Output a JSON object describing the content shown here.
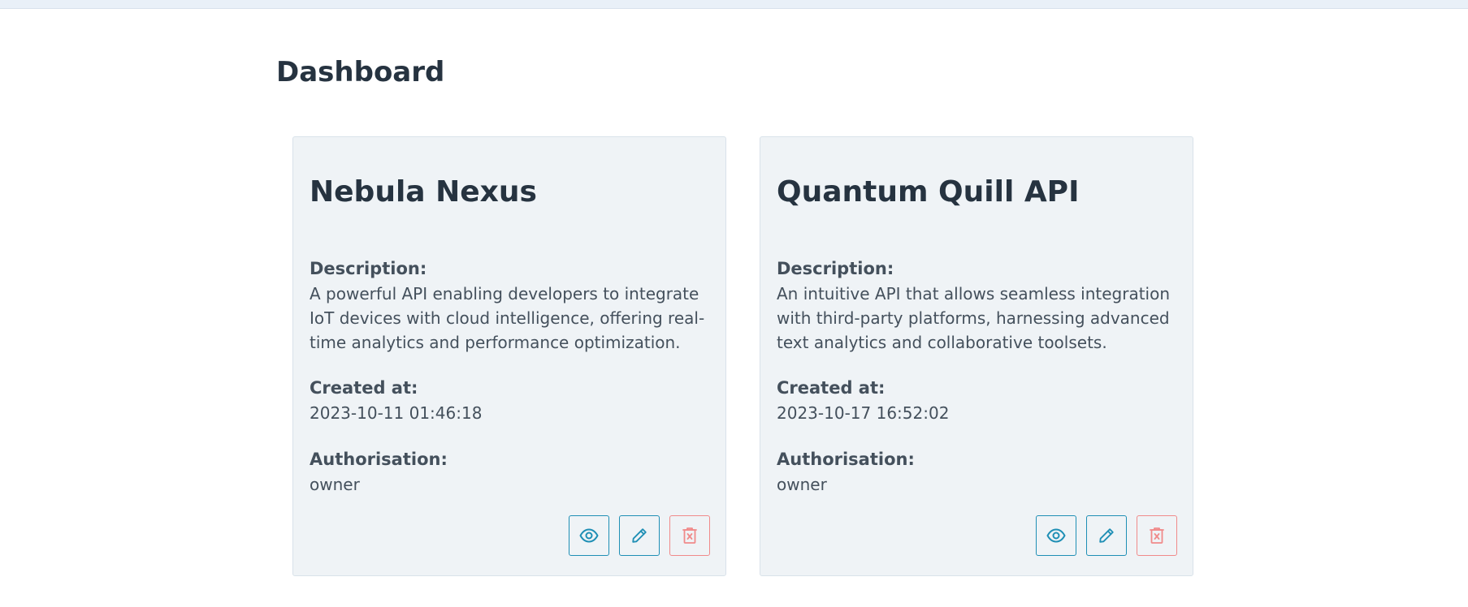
{
  "header": {
    "title": "Dashboard"
  },
  "colors": {
    "accent": "#1f8fb5",
    "danger": "#f08a8a",
    "card_bg": "#eff3f6",
    "text": "#263340"
  },
  "cards": [
    {
      "title": "Nebula Nexus",
      "description_label": "Description:",
      "description": "A powerful API enabling developers to integrate IoT devices with cloud intelligence, offering real-time analytics and performance optimization.",
      "created_label": "Created at:",
      "created_at": "2023-10-11 01:46:18",
      "authorisation_label": "Authorisation:",
      "authorisation": "owner",
      "actions": [
        "eye-icon",
        "pencil-icon",
        "trash-icon"
      ]
    },
    {
      "title": "Quantum Quill API",
      "description_label": "Description:",
      "description": "An intuitive API that allows seamless integration with third-party platforms, harnessing advanced text analytics and collaborative toolsets.",
      "created_label": "Created at:",
      "created_at": "2023-10-17 16:52:02",
      "authorisation_label": "Authorisation:",
      "authorisation": "owner",
      "actions": [
        "eye-icon",
        "pencil-icon",
        "trash-icon"
      ]
    }
  ]
}
